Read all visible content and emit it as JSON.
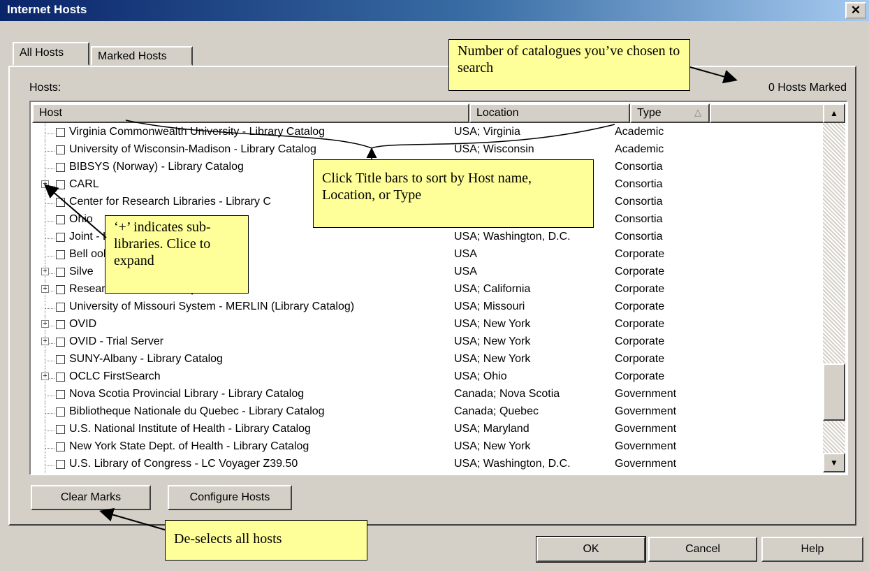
{
  "window": {
    "title": "Internet Hosts",
    "close_glyph": "✕"
  },
  "tabs": [
    {
      "label": "All Hosts"
    },
    {
      "label": "Marked Hosts"
    }
  ],
  "hosts_label": "Hosts:",
  "marked_count": "0 Hosts Marked",
  "columns": [
    {
      "label": "Host"
    },
    {
      "label": "Location"
    },
    {
      "label": "Type"
    }
  ],
  "sort_indicator": "△",
  "rows": [
    {
      "host": "Virginia Commonwealth University - Library Catalog",
      "location": "USA; Virginia",
      "type": "Academic",
      "expandable": false
    },
    {
      "host": "University of Wisconsin-Madison - Library Catalog",
      "location": "USA; Wisconsin",
      "type": "Academic",
      "expandable": false
    },
    {
      "host": "BIBSYS (Norway) - Library Catalog",
      "location": "",
      "type": "Consortia",
      "expandable": false
    },
    {
      "host": "CARL",
      "location": "",
      "type": "Consortia",
      "expandable": true
    },
    {
      "host": "Center for Research Libraries - Library C",
      "location": "",
      "type": "Consortia",
      "expandable": false
    },
    {
      "host": "Ohio",
      "location": "",
      "type": "Consortia",
      "expandable": false
    },
    {
      "host": "Joint - Library Catalog",
      "location": "USA; Washington, D.C.",
      "type": "Consortia",
      "expandable": false
    },
    {
      "host": "Bell ooks",
      "location": "USA",
      "type": "Corporate",
      "expandable": false
    },
    {
      "host": "Silve",
      "location": "USA",
      "type": "Corporate",
      "expandable": true
    },
    {
      "host": "Research Libraries Group",
      "location": "USA; California",
      "type": "Corporate",
      "expandable": true
    },
    {
      "host": "University of Missouri System - MERLIN (Library Catalog)",
      "location": "USA; Missouri",
      "type": "Corporate",
      "expandable": false
    },
    {
      "host": "OVID",
      "location": "USA; New York",
      "type": "Corporate",
      "expandable": true
    },
    {
      "host": "OVID - Trial Server",
      "location": "USA; New York",
      "type": "Corporate",
      "expandable": true
    },
    {
      "host": "SUNY-Albany - Library Catalog",
      "location": "USA; New York",
      "type": "Corporate",
      "expandable": false
    },
    {
      "host": "OCLC FirstSearch",
      "location": "USA; Ohio",
      "type": "Corporate",
      "expandable": true
    },
    {
      "host": "Nova Scotia Provincial Library - Library Catalog",
      "location": "Canada; Nova Scotia",
      "type": "Government",
      "expandable": false
    },
    {
      "host": "Bibliotheque Nationale du Quebec - Library Catalog",
      "location": "Canada; Quebec",
      "type": "Government",
      "expandable": false
    },
    {
      "host": "U.S. National Institute of Health - Library Catalog",
      "location": "USA; Maryland",
      "type": "Government",
      "expandable": false
    },
    {
      "host": "New York State Dept. of Health - Library Catalog",
      "location": "USA; New York",
      "type": "Government",
      "expandable": false
    },
    {
      "host": "U.S. Library of Congress - LC Voyager Z39.50",
      "location": "USA; Washington, D.C.",
      "type": "Government",
      "expandable": false
    }
  ],
  "scrollbar": {
    "up_glyph": "▲",
    "down_glyph": "▼"
  },
  "buttons": {
    "clear_marks": "Clear Marks",
    "configure_hosts": "Configure Hosts",
    "ok": "OK",
    "cancel": "Cancel",
    "help": "Help"
  },
  "callouts": {
    "catalogues": "Number of catalogues you’ve chosen to search",
    "sort": "Click Title bars to sort by Host name, Location, or Type",
    "plus": "‘+’ indicates sub-libraries. Clice to expand",
    "deselect": "De-selects all hosts"
  },
  "colors": {
    "dialog_bg": "#d4d0c8",
    "callout_bg": "#ffff99",
    "titlebar": "#0a246a"
  }
}
